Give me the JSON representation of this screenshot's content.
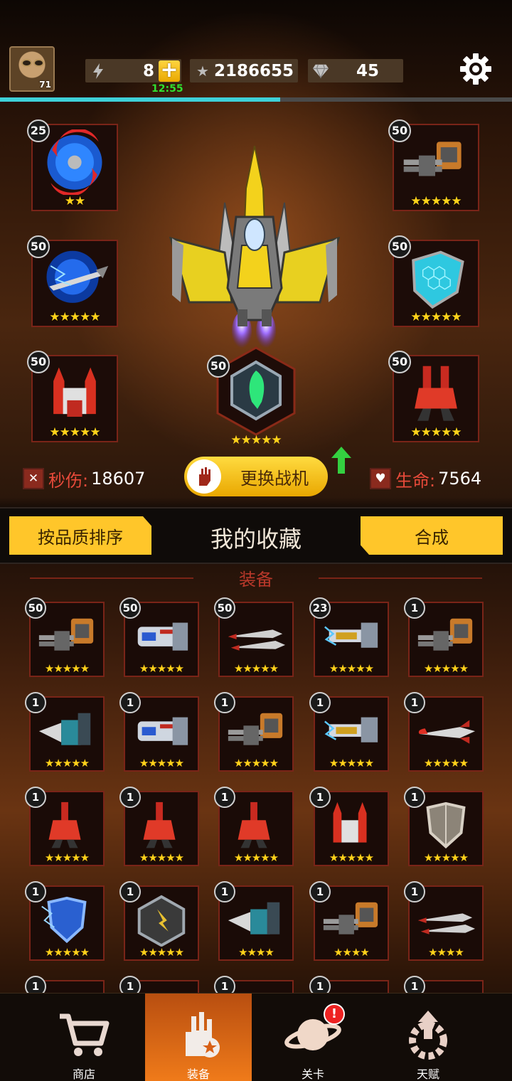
{
  "player": {
    "level": "71"
  },
  "resources": {
    "energy": "8",
    "energy_timer": "12:55",
    "stars": "2186655",
    "gems": "45"
  },
  "xp_progress": 0.547,
  "loadout": {
    "left": [
      {
        "count": "25",
        "stars": "★★",
        "icon": "crescent-blade"
      },
      {
        "count": "50",
        "stars": "★★★★★",
        "icon": "electric-missile"
      },
      {
        "count": "50",
        "stars": "★★★★★",
        "icon": "twin-rocket-pod"
      }
    ],
    "right": [
      {
        "count": "50",
        "stars": "★★★★★",
        "icon": "gatling-gun"
      },
      {
        "count": "50",
        "stars": "★★★★★",
        "icon": "hex-shield"
      },
      {
        "count": "50",
        "stars": "★★★★★",
        "icon": "red-rocket-pod"
      }
    ],
    "center": {
      "count": "50",
      "stars": "★★★★★",
      "icon": "green-hex-chip"
    }
  },
  "stats": {
    "dps_label": "秒伤:",
    "dps_value": "18607",
    "hp_label": "生命:",
    "hp_value": "7564"
  },
  "change_button": "更换战机",
  "collection": {
    "sort_button": "按品质排序",
    "title": "我的收藏",
    "merge_button": "合成",
    "section": "装备"
  },
  "grid": [
    {
      "count": "50",
      "stars": "★★★★★",
      "icon": "gatling-gun"
    },
    {
      "count": "50",
      "stars": "★★★★★",
      "icon": "plasma-cannon"
    },
    {
      "count": "50",
      "stars": "★★★★★",
      "icon": "twin-missile"
    },
    {
      "count": "23",
      "stars": "★★★★★",
      "icon": "tesla-gun"
    },
    {
      "count": "1",
      "stars": "★★★★★",
      "icon": "gatling-gun"
    },
    {
      "count": "1",
      "stars": "★★★★★",
      "icon": "drill-cannon"
    },
    {
      "count": "1",
      "stars": "★★★★★",
      "icon": "plasma-cannon"
    },
    {
      "count": "1",
      "stars": "★★★★★",
      "icon": "gatling-gun"
    },
    {
      "count": "1",
      "stars": "★★★★★",
      "icon": "tesla-gun"
    },
    {
      "count": "1",
      "stars": "★★★★★",
      "icon": "missile"
    },
    {
      "count": "1",
      "stars": "★★★★★",
      "icon": "red-rocket-pod"
    },
    {
      "count": "1",
      "stars": "★★★★★",
      "icon": "red-rocket-pod"
    },
    {
      "count": "1",
      "stars": "★★★★★",
      "icon": "red-rocket-pod"
    },
    {
      "count": "1",
      "stars": "★★★★★",
      "icon": "twin-rocket-pod"
    },
    {
      "count": "1",
      "stars": "★★★★★",
      "icon": "shield"
    },
    {
      "count": "1",
      "stars": "★★★★★",
      "icon": "electric-shield"
    },
    {
      "count": "1",
      "stars": "★★★★★",
      "icon": "gold-hex-chip"
    },
    {
      "count": "1",
      "stars": "★★★★",
      "icon": "drill-cannon"
    },
    {
      "count": "1",
      "stars": "★★★★",
      "icon": "gatling-gun"
    },
    {
      "count": "1",
      "stars": "★★★★",
      "icon": "twin-missile"
    },
    {
      "count": "1",
      "stars": "",
      "icon": "hidden"
    },
    {
      "count": "1",
      "stars": "",
      "icon": "hidden"
    },
    {
      "count": "1",
      "stars": "",
      "icon": "hidden"
    },
    {
      "count": "1",
      "stars": "",
      "icon": "hidden"
    },
    {
      "count": "1",
      "stars": "",
      "icon": "hidden"
    }
  ],
  "nav": [
    {
      "label": "商店",
      "icon": "cart-icon",
      "active": false
    },
    {
      "label": "装备",
      "icon": "equipment-icon",
      "active": true
    },
    {
      "label": "关卡",
      "icon": "planet-icon",
      "active": false,
      "badge": "!"
    },
    {
      "label": "天赋",
      "icon": "talent-icon",
      "active": false
    }
  ],
  "colors": {
    "accent": "#ffc62a",
    "tile_border": "#7a2418",
    "xp": "#3ed0d8",
    "stat_label": "#e84a3a"
  }
}
